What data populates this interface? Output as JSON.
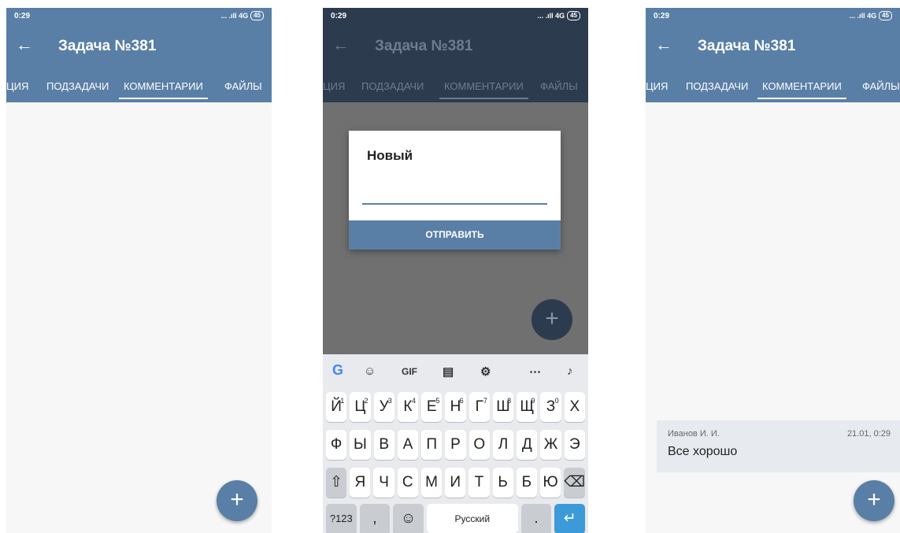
{
  "status": {
    "time": "0:29",
    "signal": "... .ıll 4G",
    "battery": "45"
  },
  "header": {
    "back_icon": "←",
    "title": "Задача №381"
  },
  "tabs": [
    {
      "label": "ЦИЯ"
    },
    {
      "label": "ПОДЗАДАЧИ"
    },
    {
      "label": "КОММЕНТАРИИ"
    },
    {
      "label": "ФАЙЛЫ"
    }
  ],
  "fab": {
    "label": "+"
  },
  "dialog": {
    "title": "Новый",
    "input_value": "",
    "send_label": "ОТПРАВИТЬ"
  },
  "keyboard": {
    "row1": [
      "Й",
      "Ц",
      "У",
      "К",
      "Е",
      "Н",
      "Г",
      "Ш",
      "Щ",
      "З",
      "Х"
    ],
    "row1_hints": [
      "1",
      "2",
      "3",
      "4",
      "5",
      "6",
      "7",
      "8",
      "9",
      "0",
      ""
    ],
    "row2": [
      "Ф",
      "Ы",
      "В",
      "А",
      "П",
      "Р",
      "О",
      "Л",
      "Д",
      "Ж",
      "Э"
    ],
    "row3": [
      "Я",
      "Ч",
      "С",
      "М",
      "И",
      "Т",
      "Ь",
      "Б",
      "Ю"
    ],
    "row4": {
      "numbers": "?123",
      "comma": ",",
      "space": "Русский",
      "period": "."
    },
    "toolbar": {
      "google": "G",
      "gif": "GIF"
    }
  },
  "comment": {
    "author": "Иванов И. И.",
    "date": "21.01, 0:29",
    "text": "Все хорошо"
  }
}
